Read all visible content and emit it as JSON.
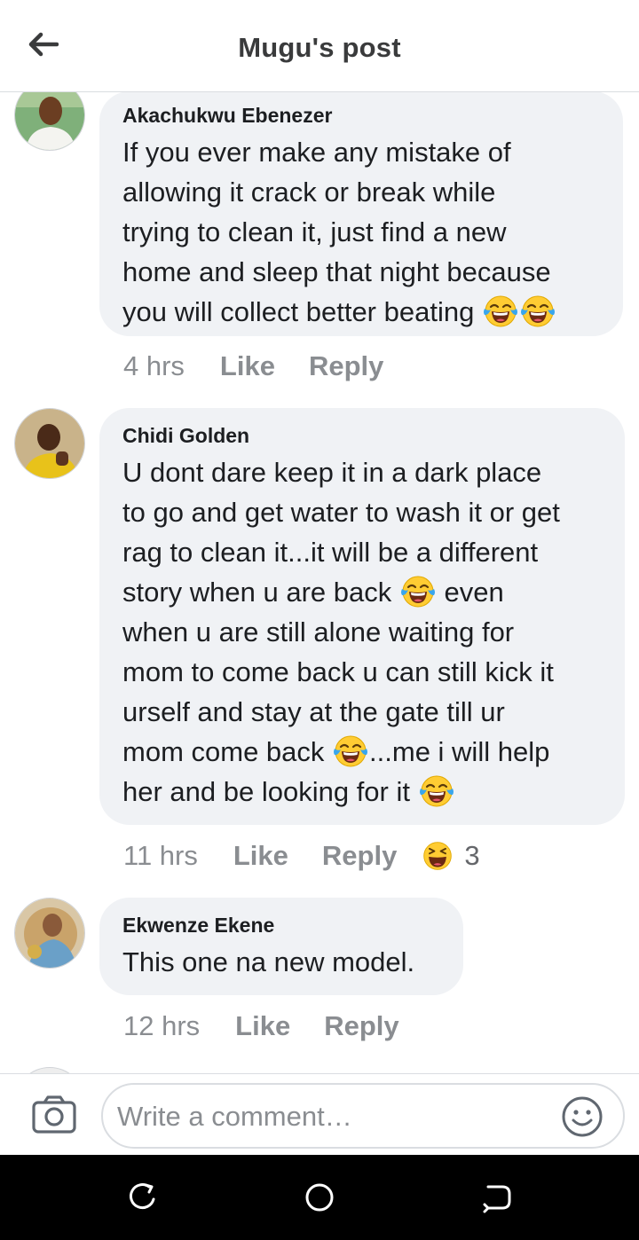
{
  "header": {
    "title": "Mugu's post",
    "back_icon": "arrow-left-icon"
  },
  "comments": [
    {
      "author": "Akachukwu Ebenezer",
      "lines": [
        "If you ever make any mistake of",
        "allowing it crack or break while",
        "trying to clean it, just find a new",
        "home and sleep that night because",
        "you will collect better beating"
      ],
      "time": "4 hrs",
      "like": "Like",
      "reply": "Reply"
    },
    {
      "author": "Chidi Golden",
      "lines": [
        "U dont dare keep it in a dark place",
        "to go and get water to wash it or get",
        "rag to clean it...it will be a different",
        "story when u are back",
        "even",
        "when u are still alone waiting for",
        "mom to come back u can still kick it",
        "urself and stay at the gate till ur",
        "mom come back",
        "...me i will help",
        "her and be looking for it"
      ],
      "time": "11 hrs",
      "like": "Like",
      "reply": "Reply",
      "reaction_count": "3"
    },
    {
      "author": "Ekwenze Ekene",
      "lines": [
        "This one na new model."
      ],
      "time": "12 hrs",
      "like": "Like",
      "reply": "Reply"
    }
  ],
  "composer": {
    "placeholder": "Write a comment…",
    "camera_icon": "camera-icon",
    "emoji_icon": "smiley-icon"
  },
  "navbar": {
    "recent_icon": "recent-apps-icon",
    "home_icon": "home-icon",
    "back_icon": "nav-back-icon"
  },
  "colors": {
    "bubble": "#f0f2f5",
    "meta_text": "#8a8d91",
    "header_text": "#3a3b3c",
    "navbar": "#000000"
  }
}
